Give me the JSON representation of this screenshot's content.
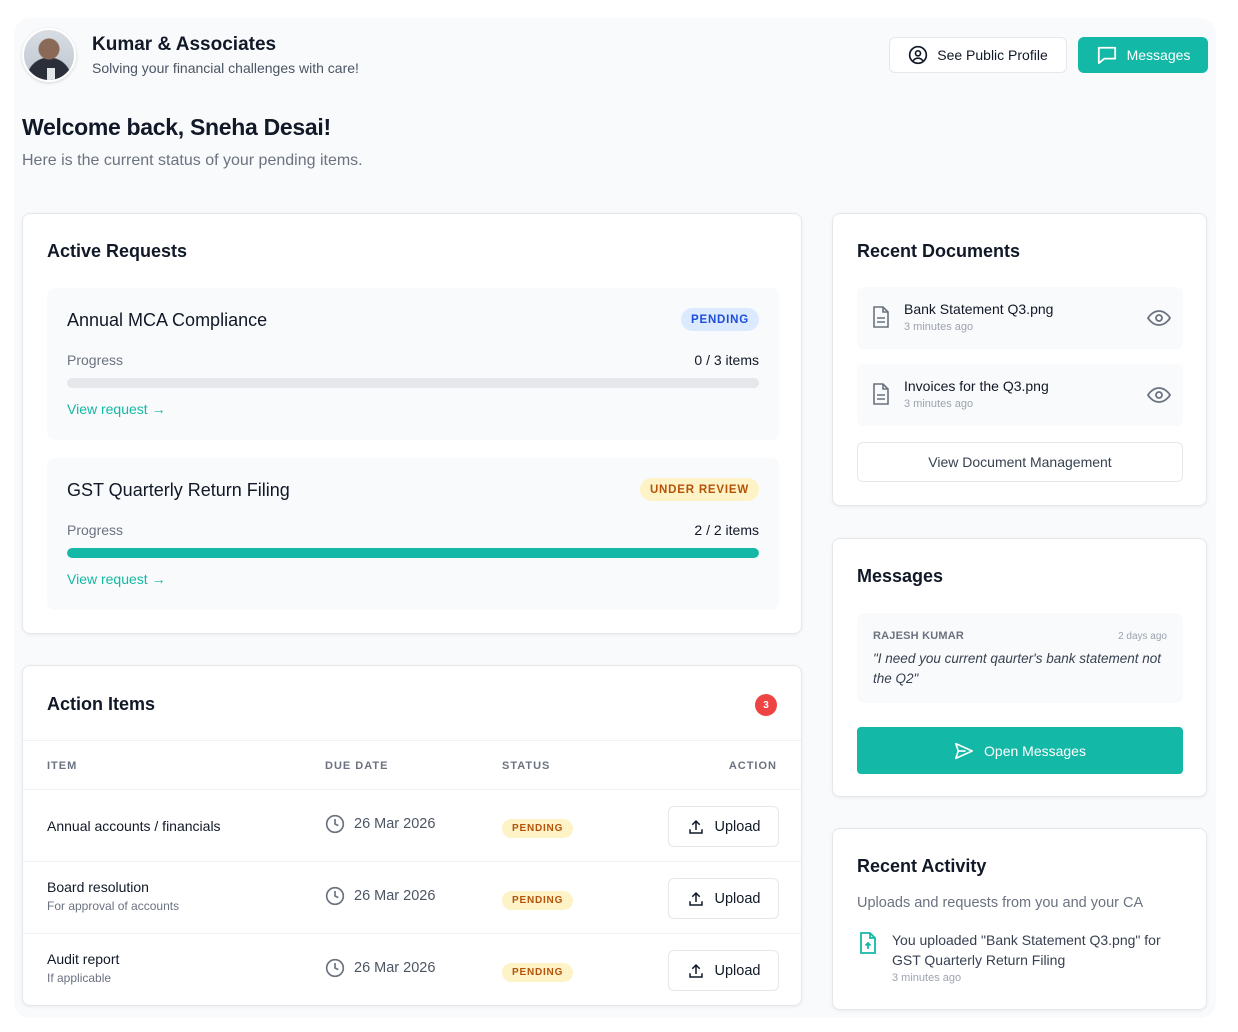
{
  "header": {
    "firm_name": "Kumar & Associates",
    "tagline": "Solving your financial challenges with care!",
    "public_profile_label": "See Public Profile",
    "messages_label": "Messages"
  },
  "welcome": {
    "title": "Welcome back, Sneha Desai!",
    "subtitle": "Here is the current status of your pending items."
  },
  "active_requests": {
    "title": "Active Requests",
    "items": [
      {
        "name": "Annual MCA Compliance",
        "status": "PENDING",
        "progress_label": "Progress",
        "progress_text": "0 / 3 items",
        "progress_fraction": 0,
        "link": "View request →"
      },
      {
        "name": "GST Quarterly Return Filing",
        "status": "UNDER REVIEW",
        "progress_label": "Progress",
        "progress_text": "2 / 2 items",
        "progress_fraction": 1,
        "link": "View request →"
      }
    ]
  },
  "action_items": {
    "title": "Action Items",
    "count": "3",
    "columns": [
      "ITEM",
      "DUE DATE",
      "STATUS",
      "ACTION"
    ],
    "rows": [
      {
        "item": "Annual accounts / financials",
        "sub": "",
        "due": "26 Mar 2026",
        "status": "PENDING",
        "action": "Upload"
      },
      {
        "item": "Board resolution",
        "sub": "For approval of accounts",
        "due": "26 Mar 2026",
        "status": "PENDING",
        "action": "Upload"
      },
      {
        "item": "Audit report",
        "sub": "If applicable",
        "due": "26 Mar 2026",
        "status": "PENDING",
        "action": "Upload"
      }
    ]
  },
  "recent_documents": {
    "title": "Recent Documents",
    "items": [
      {
        "name": "Bank Statement Q3.png",
        "time": "3 minutes ago"
      },
      {
        "name": "Invoices for the Q3.png",
        "time": "3 minutes ago"
      }
    ],
    "button": "View Document Management"
  },
  "messages": {
    "title": "Messages",
    "sender": "RAJESH KUMAR",
    "time": "2 days ago",
    "text": "\"I need you current qaurter's bank statement not the Q2\"",
    "button": "Open Messages"
  },
  "recent_activity": {
    "title": "Recent Activity",
    "subtitle": "Uploads and requests from you and your CA",
    "item_text": "You uploaded \"Bank Statement Q3.png\" for GST Quarterly Return Filing",
    "item_time": "3 minutes ago"
  },
  "colors": {
    "accent": "#14b8a6",
    "badge_red": "#ef4444",
    "pending_blue_bg": "#dbeafe",
    "review_bg": "#fef3c7"
  }
}
